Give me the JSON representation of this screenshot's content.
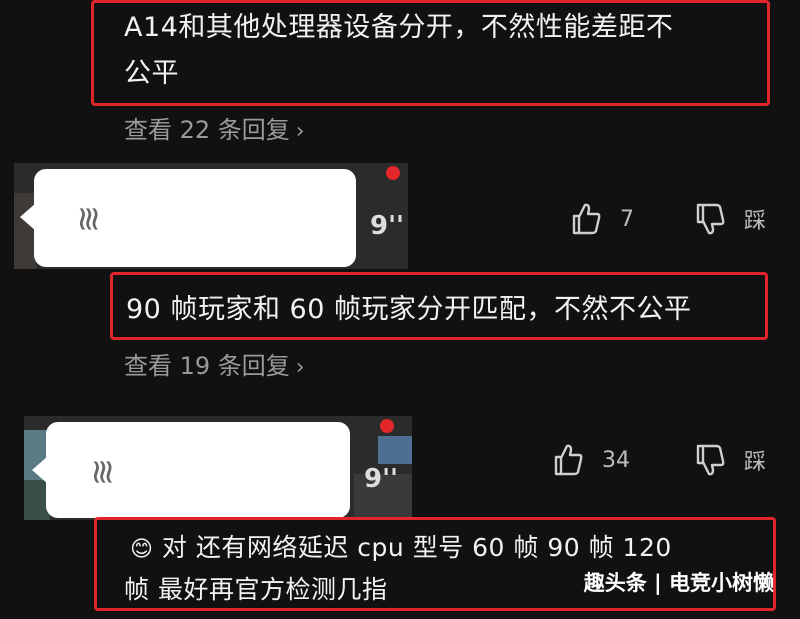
{
  "colors": {
    "background": "#111111",
    "highlight": "#e0262b",
    "muted": "#9a9a9a"
  },
  "comments": [
    {
      "text_line1": "A14和其他处理器设备分开，不然性能差距不",
      "text_line2": "公平",
      "view_replies": "查看 22 条回复"
    },
    {
      "voice_duration": "9''",
      "like_count": "7",
      "dislike_label": "踩",
      "text_line1": "90 帧玩家和 60 帧玩家分开匹配，不然不公平",
      "view_replies": "查看 19 条回复"
    },
    {
      "voice_duration": "9''",
      "like_count": "34",
      "dislike_label": "踩",
      "emoji": "😊",
      "text_line1": "对 还有网络延迟 cpu 型号 60 帧 90 帧 120",
      "text_line2": "帧 最好再官方检测几指"
    }
  ],
  "watermark": "趣头条 | 电竞小树懒",
  "icons": [
    "chevron-right-icon",
    "voice-wave-icon",
    "thumbs-up-icon",
    "thumbs-down-icon",
    "recording-dot-icon"
  ]
}
